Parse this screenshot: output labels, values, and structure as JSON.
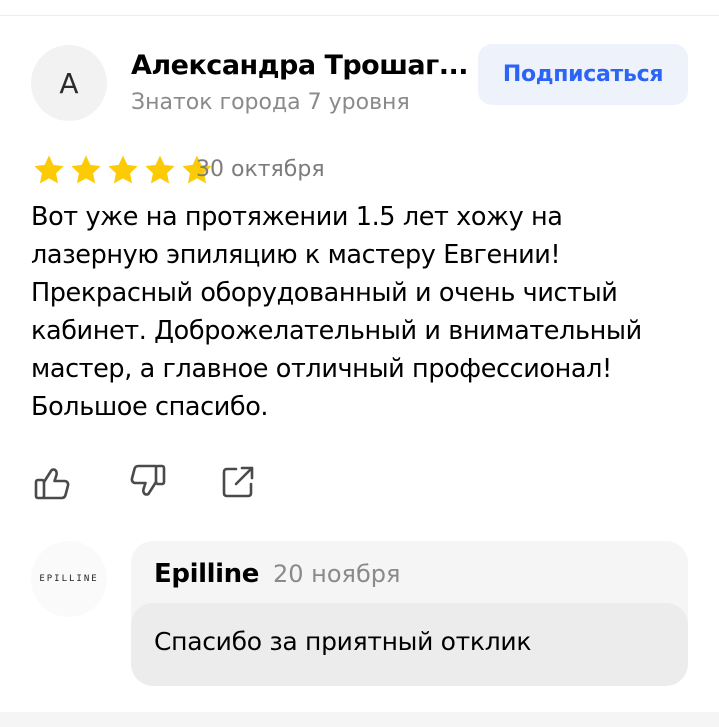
{
  "review": {
    "author": {
      "initial": "А",
      "name": "Александра Трошаг...",
      "level": "Знаток города 7 уровня"
    },
    "subscribe_label": "Подписаться",
    "rating": 5,
    "date": "30 октября",
    "text": "Вот уже на протяжении 1.5 лет хожу на лазерную эпиляцию к мастеру Евгении! Прекрасный оборудованный и очень чистый кабинет. Доброжелательный и внимательный мастер, а главное отличный профессионал! Большое спасибо.",
    "actions": [
      "like-icon",
      "dislike-icon",
      "share-icon"
    ]
  },
  "reply": {
    "logo_text": "EPILLINE",
    "author": "Epilline",
    "date": "20 ноября",
    "text": "Спасибо за приятный отклик"
  },
  "colors": {
    "star": "#FCCB05",
    "accent": "#2C64F6",
    "muted_text": "#8A8A8A",
    "card_bg": "#F5F5F5"
  }
}
